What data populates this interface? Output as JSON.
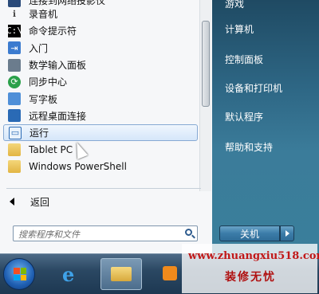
{
  "left_pane": {
    "items": [
      {
        "label": "连接到网络投影仪",
        "icon": "network-projector-icon"
      },
      {
        "label": "录音机",
        "icon": "microphone-icon"
      },
      {
        "label": "命令提示符",
        "icon": "command-prompt-icon"
      },
      {
        "label": "入门",
        "icon": "getting-started-icon"
      },
      {
        "label": "数学输入面板",
        "icon": "math-input-panel-icon"
      },
      {
        "label": "同步中心",
        "icon": "sync-center-icon"
      },
      {
        "label": "写字板",
        "icon": "wordpad-icon"
      },
      {
        "label": "远程桌面连接",
        "icon": "remote-desktop-icon"
      },
      {
        "label": "运行",
        "icon": "run-icon"
      },
      {
        "label": "Tablet PC",
        "icon": "folder-icon"
      },
      {
        "label": "Windows PowerShell",
        "icon": "folder-icon"
      }
    ],
    "back_label": "返回",
    "search_placeholder": "搜索程序和文件"
  },
  "right_pane": {
    "items": [
      "游戏",
      "计算机",
      "控制面板",
      "设备和打印机",
      "默认程序",
      "帮助和支持"
    ],
    "shutdown_label": "关机"
  },
  "taskbar": {
    "apps": [
      "start-orb",
      "internet-explorer",
      "windows-explorer",
      "media-player"
    ]
  },
  "watermark": {
    "url": "www.zhuangxiu518.com",
    "text": "装修无忧"
  }
}
